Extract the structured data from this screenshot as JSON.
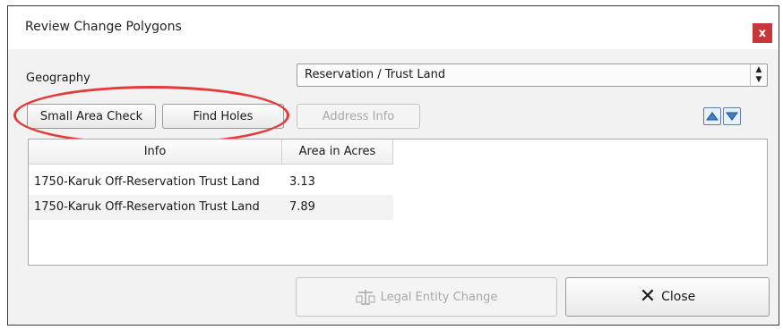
{
  "dialog": {
    "title": "Review Change Polygons",
    "close_glyph": "x"
  },
  "geography": {
    "label": "Geography",
    "selected": "Reservation / Trust Land",
    "spin_up": "▲",
    "spin_down": "▼"
  },
  "toolbar": {
    "small_area_check": "Small Area Check",
    "find_holes": "Find Holes",
    "address_info": "Address Info",
    "move_up_icon": "up-arrow-icon",
    "move_down_icon": "down-arrow-icon"
  },
  "table": {
    "columns": [
      "Info",
      "Area in Acres"
    ],
    "rows": [
      {
        "info": "1750-Karuk Off-Reservation Trust Land",
        "area": "3.13"
      },
      {
        "info": "1750-Karuk Off-Reservation Trust Land",
        "area": "7.89"
      }
    ]
  },
  "footer": {
    "legal_entity_change": "Legal Entity Change",
    "close": "Close",
    "legal_icon": "scale-icon",
    "close_icon": "x-icon"
  },
  "colors": {
    "close_button": "#c8363a",
    "highlight_ring": "#e53a3a",
    "arrow_buttons": "#3f7fd0"
  }
}
